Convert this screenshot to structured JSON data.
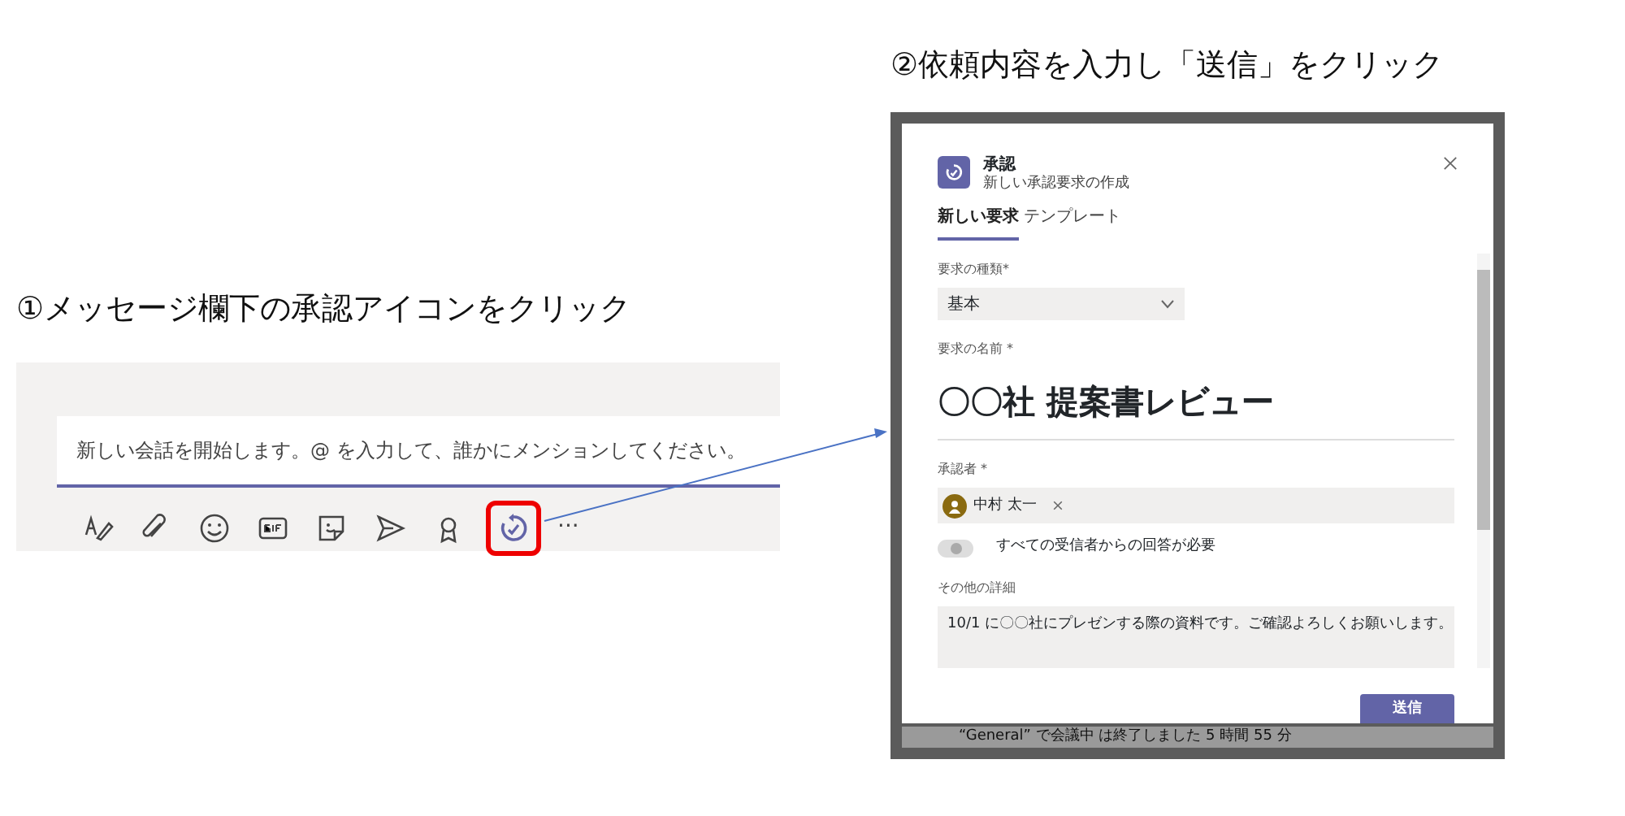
{
  "steps": [
    {
      "caption": "①メッセージ欄下の承認アイコンをクリック"
    },
    {
      "caption": "②依頼内容を入力し「送信」をクリック"
    }
  ],
  "composer": {
    "placeholder": "新しい会話を開始します。@ を入力して、誰かにメンションしてください。",
    "toolbar": [
      {
        "kind": "format",
        "highlighted": false
      },
      {
        "kind": "attach",
        "highlighted": false
      },
      {
        "kind": "emoji",
        "highlighted": false
      },
      {
        "kind": "gif",
        "highlighted": false
      },
      {
        "kind": "sticker",
        "highlighted": false
      },
      {
        "kind": "send",
        "highlighted": false
      },
      {
        "kind": "praise",
        "highlighted": false
      },
      {
        "kind": "approvals",
        "highlighted": true
      }
    ],
    "more": "···"
  },
  "dialog": {
    "app_name": "承認",
    "subtitle": "新しい承認要求の作成",
    "tabs": [
      {
        "label": "新しい要求",
        "selected": true
      },
      {
        "label": "テンプレート",
        "selected": false
      }
    ],
    "request_type": {
      "label": "要求の種類*",
      "value": "基本"
    },
    "request_name": {
      "label": "要求の名前 *",
      "value": "〇〇社 提案書レビュー"
    },
    "approvers": {
      "label": "承認者 *",
      "people": [
        {
          "name": "中村 太一"
        }
      ]
    },
    "require_all": {
      "label": "すべての受信者からの回答が必要",
      "on": false
    },
    "details": {
      "label": "その他の詳細",
      "value": "10/1 に〇〇社にプレゼンする際の資料です。ご確認よろしくお願いします。"
    },
    "submit": "送信"
  },
  "background_message": "“General” で会議中 は終了しました 5 時間 55 分"
}
